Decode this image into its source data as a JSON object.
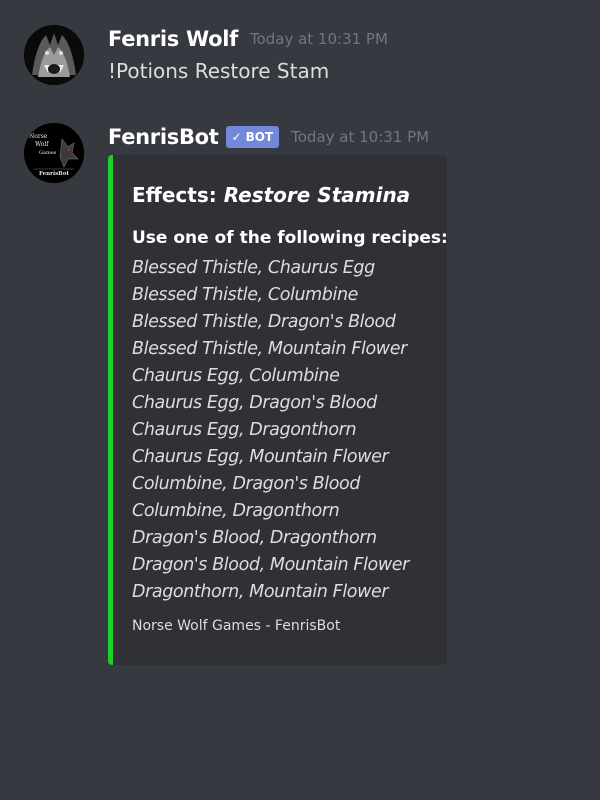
{
  "colors": {
    "background": "#36393f",
    "embed_background": "#2f3136",
    "embed_accent": "#1bd127",
    "bot_tag": "#7289da",
    "timestamp": "#72767d"
  },
  "messages": [
    {
      "username": "Fenris Wolf",
      "timestamp": "Today at 10:31 PM",
      "avatar_icon": "wolf-avatar-icon",
      "content": "!Potions Restore Stam"
    },
    {
      "username": "FenrisBot",
      "bot_tag": "BOT",
      "timestamp": "Today at 10:31 PM",
      "avatar_icon": "norse-wolf-games-logo",
      "avatar_logo_text": [
        "Norse",
        "Wolf",
        "Games",
        "FenrisBot"
      ],
      "embed": {
        "title_prefix": "Effects:",
        "title_effect": "Restore Stamina",
        "field_name": "Use one of the following recipes:",
        "recipes": [
          "Blessed Thistle, Chaurus Egg",
          "Blessed Thistle, Columbine",
          "Blessed Thistle, Dragon's Blood",
          "Blessed Thistle, Mountain Flower",
          "Chaurus Egg, Columbine",
          "Chaurus Egg, Dragon's Blood",
          "Chaurus Egg, Dragonthorn",
          "Chaurus Egg, Mountain Flower",
          "Columbine, Dragon's Blood",
          "Columbine, Dragonthorn",
          "Dragon's Blood, Dragonthorn",
          "Dragon's Blood, Mountain Flower",
          "Dragonthorn, Mountain Flower"
        ],
        "footer": "Norse Wolf Games - FenrisBot"
      }
    }
  ]
}
